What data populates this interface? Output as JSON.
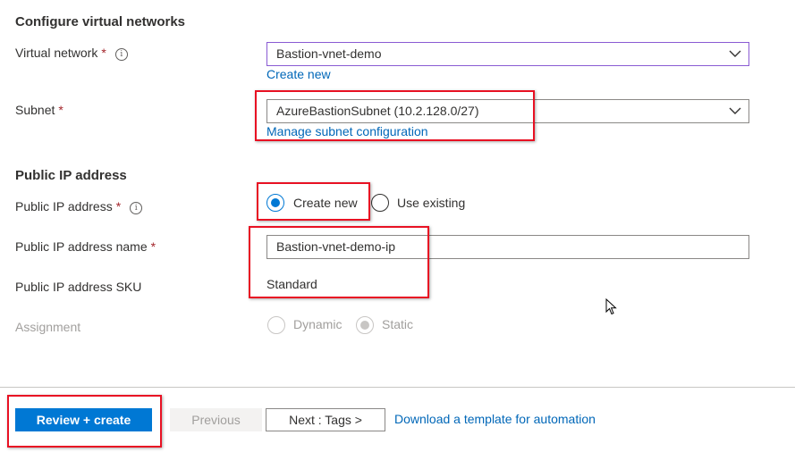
{
  "vnet_section": {
    "title": "Configure virtual networks",
    "virtual_network": {
      "label": "Virtual network",
      "required_mark": "*",
      "info_glyph": "i",
      "value": "Bastion-vnet-demo",
      "create_new_link": "Create new"
    },
    "subnet": {
      "label": "Subnet",
      "required_mark": "*",
      "value": "AzureBastionSubnet (10.2.128.0/27)",
      "manage_link": "Manage subnet configuration"
    }
  },
  "public_ip_section": {
    "title": "Public IP address",
    "address": {
      "label": "Public IP address",
      "required_mark": "*",
      "info_glyph": "i",
      "options": [
        "Create new",
        "Use existing"
      ],
      "selected": "Create new"
    },
    "name": {
      "label": "Public IP address name",
      "required_mark": "*",
      "value": "Bastion-vnet-demo-ip"
    },
    "sku": {
      "label": "Public IP address SKU",
      "value": "Standard"
    },
    "assignment": {
      "label": "Assignment",
      "options": [
        "Dynamic",
        "Static"
      ],
      "selected": "Static",
      "disabled": true
    }
  },
  "footer": {
    "review_create": "Review + create",
    "previous": "Previous",
    "next": "Next : Tags >",
    "download_link": "Download a template for automation"
  },
  "colors": {
    "accent": "#0078d4",
    "link": "#0067b8",
    "required": "#a4262c",
    "annotation_box": "#e81123"
  },
  "icons": [
    "info-icon",
    "chevron-down-icon",
    "mouse-cursor-icon"
  ]
}
